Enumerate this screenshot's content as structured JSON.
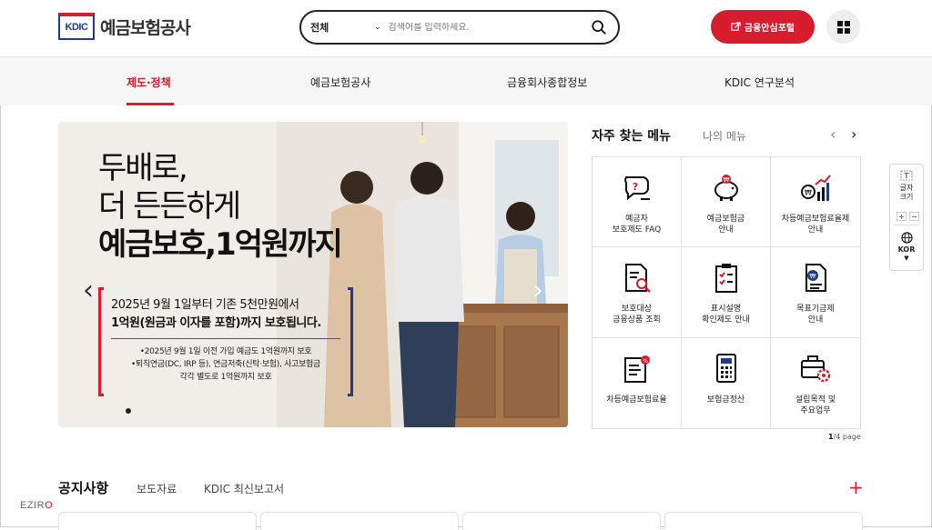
{
  "header": {
    "logo_mark": "KDIC",
    "logo_text": "예금보험공사",
    "search": {
      "category": "전체",
      "placeholder": "검색어를 입력하세요."
    },
    "portal_button": "금융안심포털"
  },
  "gnb": {
    "items": [
      {
        "label": "제도·정책",
        "active": true
      },
      {
        "label": "예금보험공사",
        "active": false
      },
      {
        "label": "금융회사종합정보",
        "active": false
      },
      {
        "label": "KDIC 연구분석",
        "active": false
      }
    ]
  },
  "banner": {
    "title_line1": "두배로,",
    "title_line2": "더 든든하게",
    "title_line3": "예금보호,1억원까지",
    "line1": "2025년 9월 1일부터 기존 5천만원에서",
    "line2": "1억원(원금과 이자를 포함)까지 보호됩니다.",
    "note1": "•2025년 9월 1일 이전 가입 예금도 1억원까지 보호",
    "note2": "•퇴직연금(DC, IRP 등), 연금저축(신탁·보험), 사고보험금",
    "note3": "각각 별도로 1억원까지 보호"
  },
  "menu": {
    "tab_frequent": "자주 찾는 메뉴",
    "tab_mine": "나의 메뉴",
    "items": [
      {
        "label": "예금자\n보호제도 FAQ",
        "icon": "faq-icon"
      },
      {
        "label": "예금보험금\n안내",
        "icon": "piggy-bank-icon"
      },
      {
        "label": "차등예금보험료율제\n안내",
        "icon": "growth-chart-icon"
      },
      {
        "label": "보호대상\n금융상품 조회",
        "icon": "document-search-icon"
      },
      {
        "label": "표시설명\n확인제도 안내",
        "icon": "checklist-icon"
      },
      {
        "label": "목표기금제\n안내",
        "icon": "fund-document-icon"
      },
      {
        "label": "차등예금보험료율",
        "icon": "rate-document-icon"
      },
      {
        "label": "보험금정산",
        "icon": "calculator-icon"
      },
      {
        "label": "설립목적 및\n주요업무",
        "icon": "briefcase-gear-icon"
      }
    ],
    "page_current": "1",
    "page_total": "/4 page"
  },
  "side_widget": {
    "font_label_1": "글자",
    "font_label_2": "크기",
    "plus": "+",
    "minus": "−",
    "lang": "KOR"
  },
  "notice": {
    "tab1": "공지사항",
    "tab2": "보도자료",
    "tab3": "KDIC 최신보고서",
    "more": "+"
  },
  "watermark": {
    "brand_a": "EZIR",
    "brand_b": "O"
  },
  "colors": {
    "brand_red": "#d61c2d",
    "brand_navy": "#1f3b8a"
  }
}
